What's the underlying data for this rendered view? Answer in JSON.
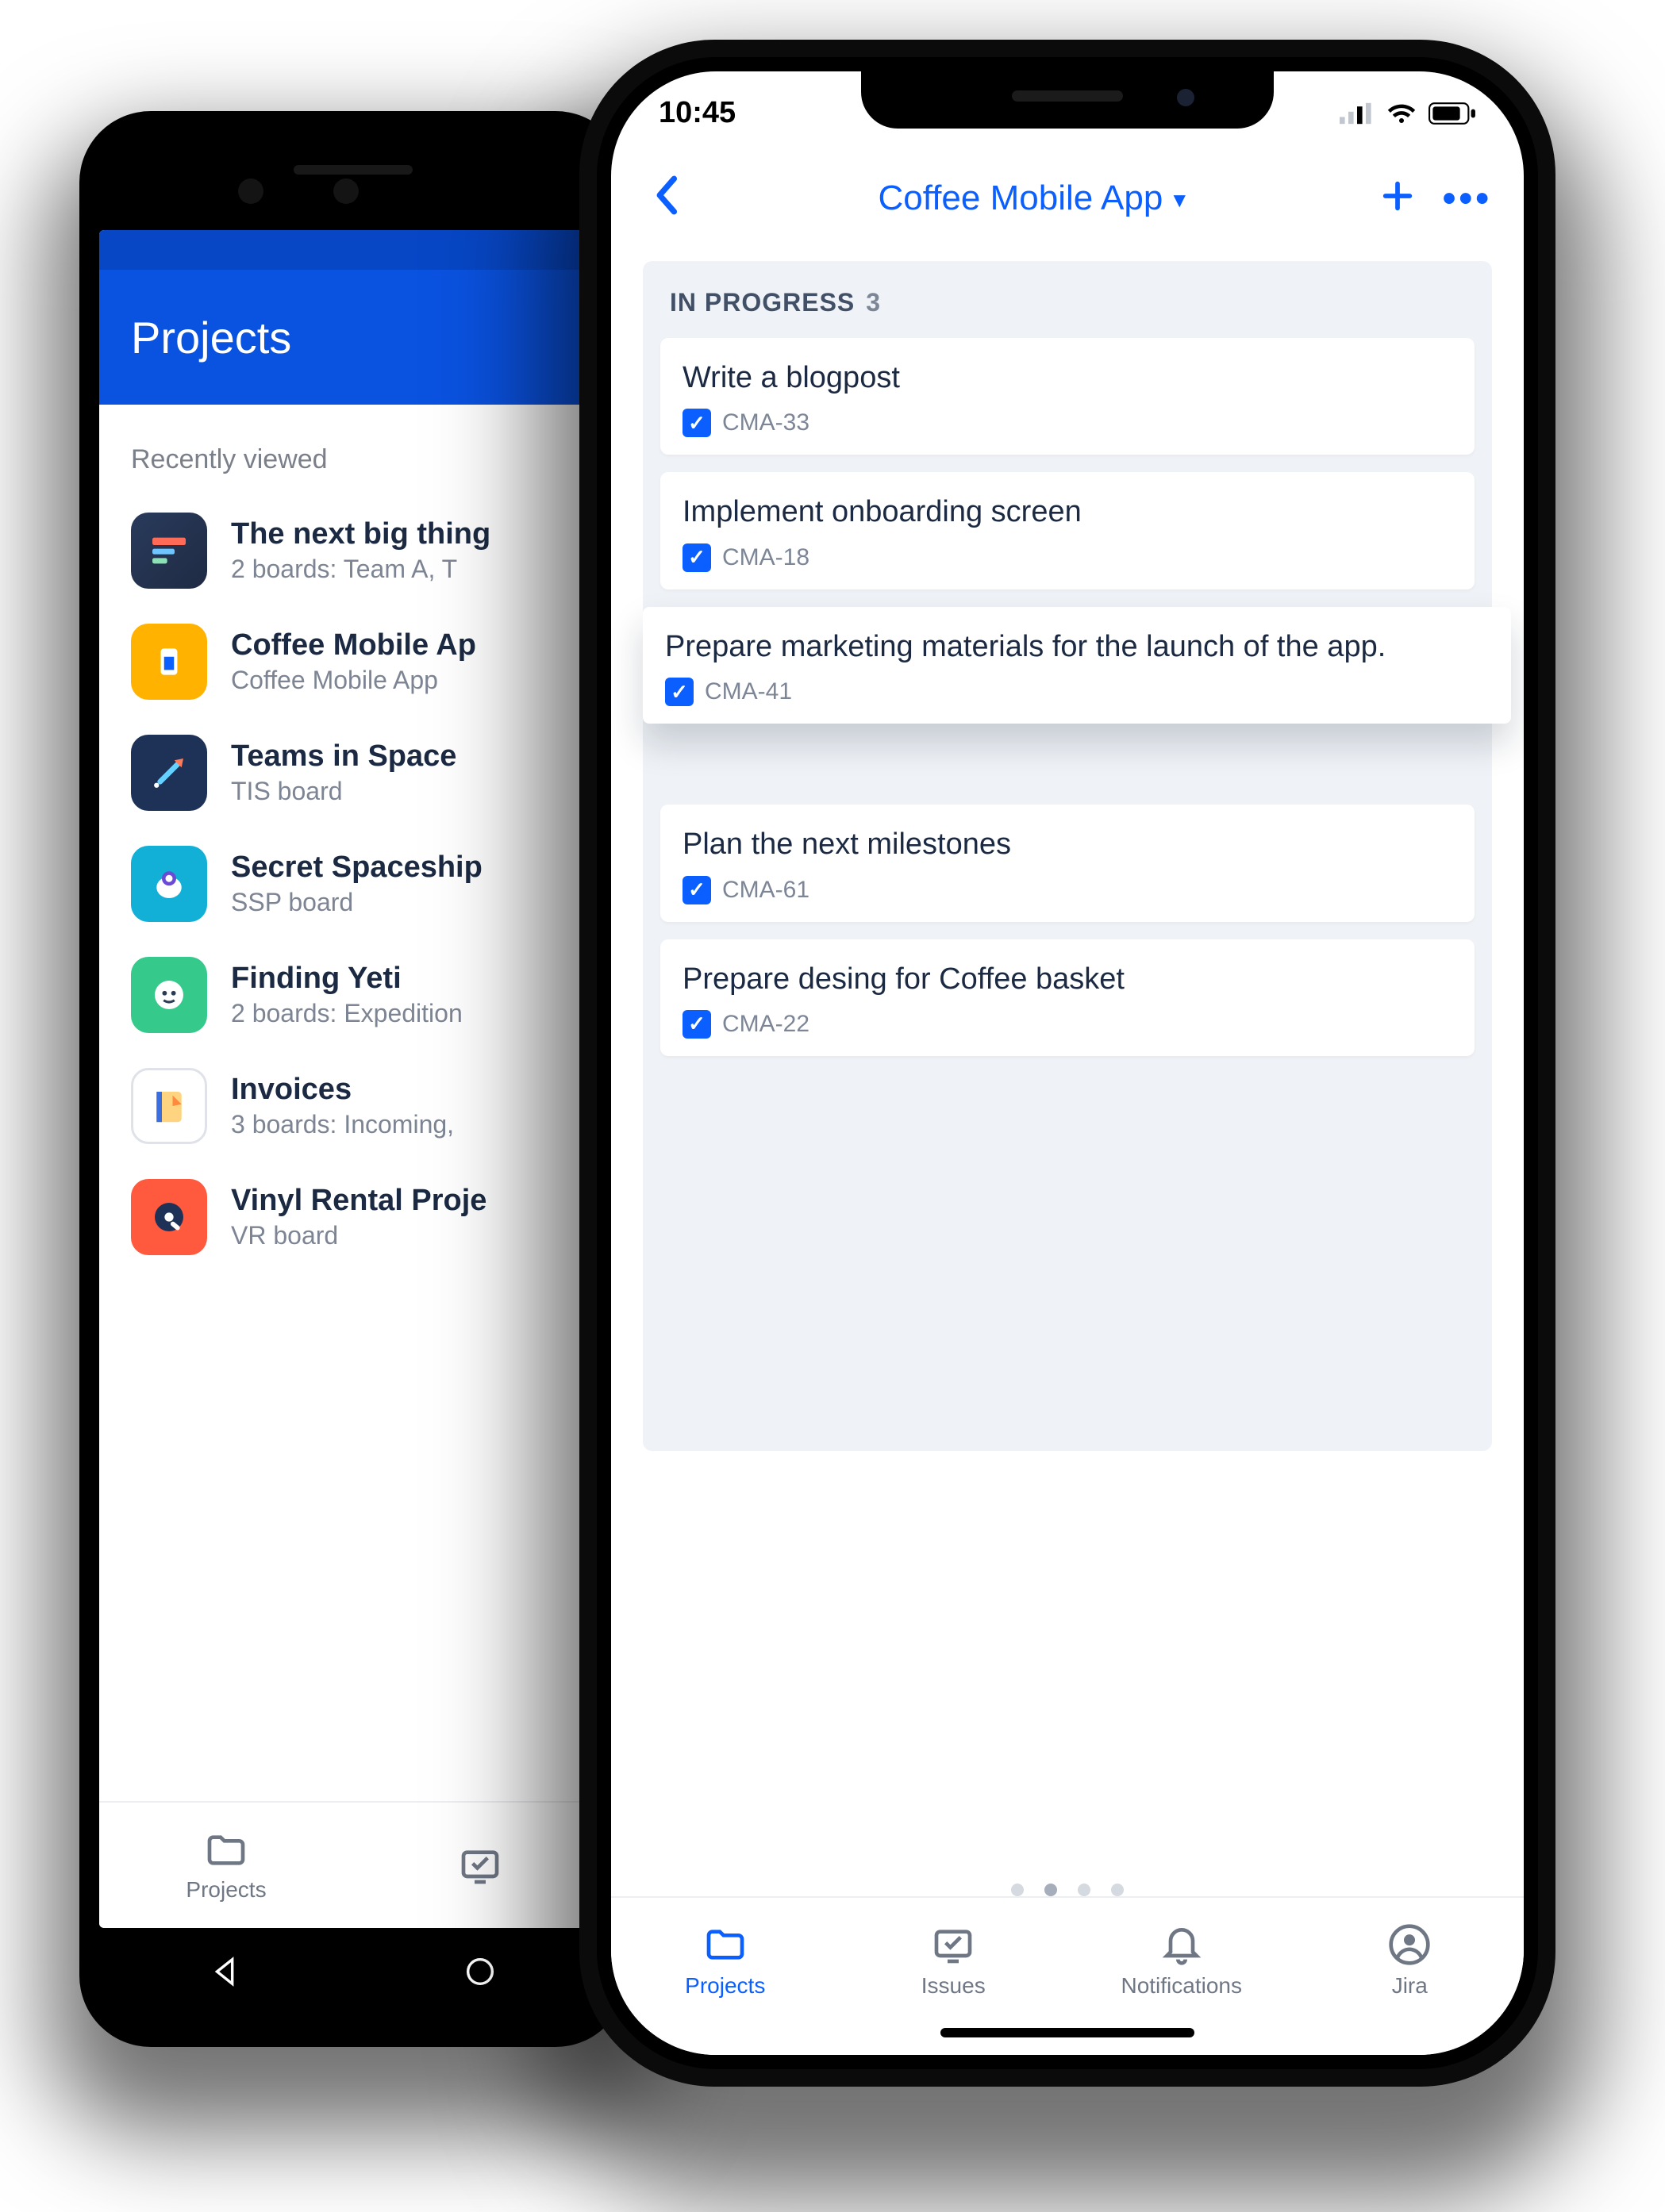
{
  "android": {
    "header_title": "Projects",
    "section_label": "Recently viewed",
    "projects": [
      {
        "title": "The next big thing",
        "subtitle": "2 boards: Team A, T"
      },
      {
        "title": "Coffee Mobile Ap",
        "subtitle": "Coffee Mobile App"
      },
      {
        "title": "Teams in Space",
        "subtitle": "TIS board"
      },
      {
        "title": "Secret Spaceship",
        "subtitle": "SSP board"
      },
      {
        "title": "Finding Yeti",
        "subtitle": "2 boards: Expedition"
      },
      {
        "title": "Invoices",
        "subtitle": "3 boards: Incoming,"
      },
      {
        "title": "Vinyl Rental Proje",
        "subtitle": "VR board"
      }
    ],
    "tab_projects_label": "Projects"
  },
  "ios": {
    "status_time": "10:45",
    "nav_title": "Coffee Mobile App",
    "column": {
      "name": "IN PROGRESS",
      "count": "3"
    },
    "cards": [
      {
        "title": "Write a blogpost",
        "key": "CMA-33"
      },
      {
        "title": "Implement onboarding screen",
        "key": "CMA-18"
      },
      {
        "title": "Prepare marketing materials for the launch of the app.",
        "key": "CMA-41"
      },
      {
        "title": "Plan the next milestones",
        "key": "CMA-61"
      },
      {
        "title": "Prepare desing for Coffee basket",
        "key": "CMA-22"
      }
    ],
    "tabs": {
      "projects": "Projects",
      "issues": "Issues",
      "notifications": "Notifications",
      "jira": "Jira"
    }
  }
}
